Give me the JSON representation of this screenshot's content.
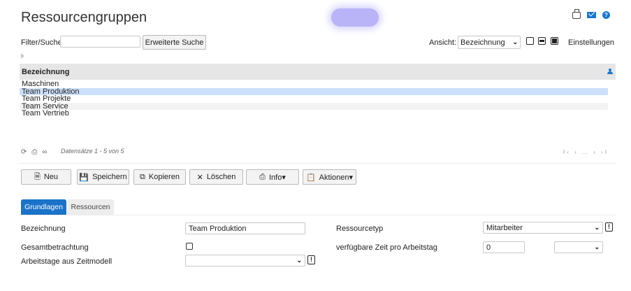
{
  "page": {
    "title": "Ressourcengruppen"
  },
  "filter": {
    "label": "Filter/Suche:",
    "value": "",
    "extended_search_label": "Erweiterte Suche"
  },
  "view": {
    "label": "Ansicht:",
    "selected": "Bezeichnung",
    "settings_label": "Einstellungen"
  },
  "list": {
    "header": "Bezeichnung",
    "rows": [
      "Maschinen",
      "Team Produktion",
      "Team Projekte",
      "Team Service",
      "Team Vertrieb"
    ],
    "selected_index": 1,
    "records_text": "Datensätze 1 - 5 von 5",
    "pager_text": "I‹ ‹ … › ›I"
  },
  "toolbar": {
    "new_label": "Neu",
    "save_label": "Speichern",
    "copy_label": "Kopieren",
    "delete_label": "Löschen",
    "info_label": "Info▾",
    "actions_label": "Aktionen▾"
  },
  "tabs": [
    {
      "label": "Grundlagen",
      "active": true
    },
    {
      "label": "Ressourcen",
      "active": false
    }
  ],
  "form": {
    "name_label": "Bezeichnung",
    "name_value": "Team Produktion",
    "type_label": "Ressourcetyp",
    "type_value": "Mitarbeiter",
    "overall_label": "Gesamtbetrachtung",
    "time_label": "verfügbare Zeit pro Arbeitstag",
    "time_value": "0",
    "time_unit_value": "",
    "workdays_label": "Arbeitstage aus Zeitmodell",
    "workdays_value": "",
    "excl": "!"
  },
  "colors": {
    "accent": "#1a73c9",
    "selected_row": "#cde0fb",
    "header_bg": "#e6e6e6"
  }
}
